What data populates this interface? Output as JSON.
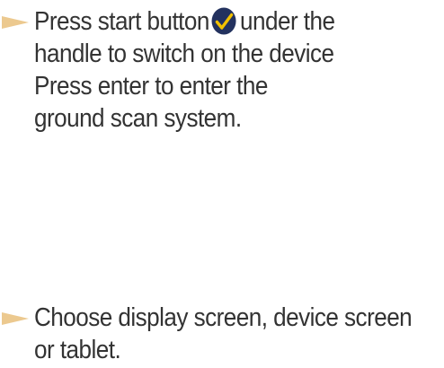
{
  "instructions": [
    {
      "id": "power-on",
      "lines": [
        {
          "before_icon": "Press start button",
          "icon": "checkmark-icon",
          "after_icon": "under the"
        },
        {
          "text": "handle to switch on the device"
        },
        {
          "text": "Press enter to enter the"
        },
        {
          "text": "ground scan system."
        }
      ]
    },
    {
      "id": "display-choice",
      "lines": [
        {
          "text": "Choose display screen, device screen"
        },
        {
          "text": "or tablet."
        }
      ]
    }
  ],
  "colors": {
    "text": "#333333",
    "bullet": "#ecc98f",
    "check_circle": "#23325f",
    "check_mark": "#f2c100"
  }
}
